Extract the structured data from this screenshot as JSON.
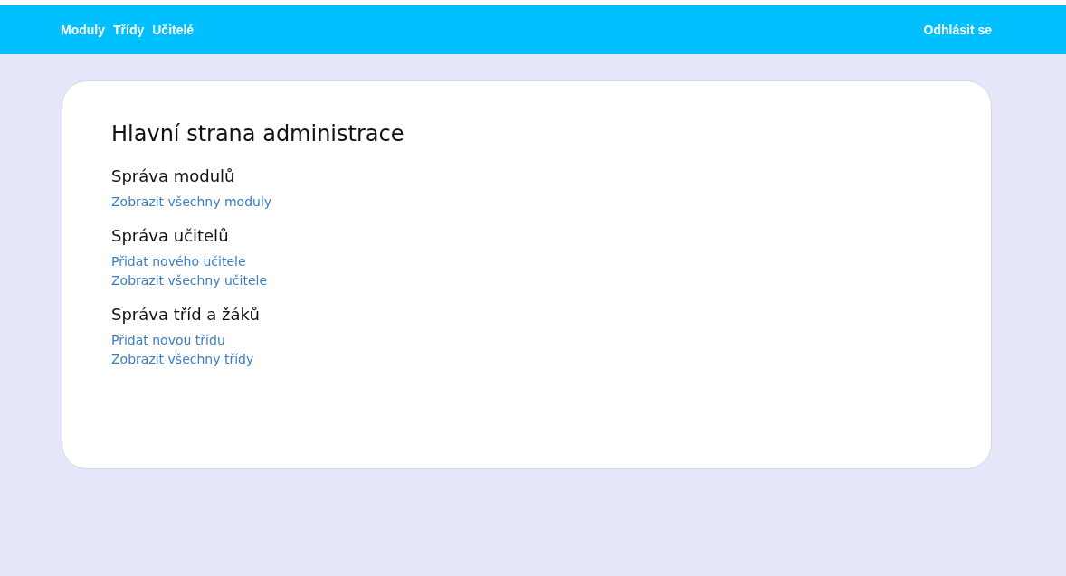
{
  "nav": {
    "items": [
      {
        "label": "Moduly"
      },
      {
        "label": "Třídy"
      },
      {
        "label": "Učitelé"
      }
    ],
    "logout": "Odhlásit se"
  },
  "page": {
    "title": "Hlavní strana administrace",
    "sections": [
      {
        "heading": "Správa modulů",
        "links": [
          "Zobrazit všechny moduly"
        ]
      },
      {
        "heading": "Správa učitelů",
        "links": [
          "Přidat nového učitele",
          "Zobrazit všechny učitele"
        ]
      },
      {
        "heading": "Správa tříd a žáků",
        "links": [
          "Přidat novou třídu",
          "Zobrazit všechny třídy"
        ]
      }
    ]
  }
}
